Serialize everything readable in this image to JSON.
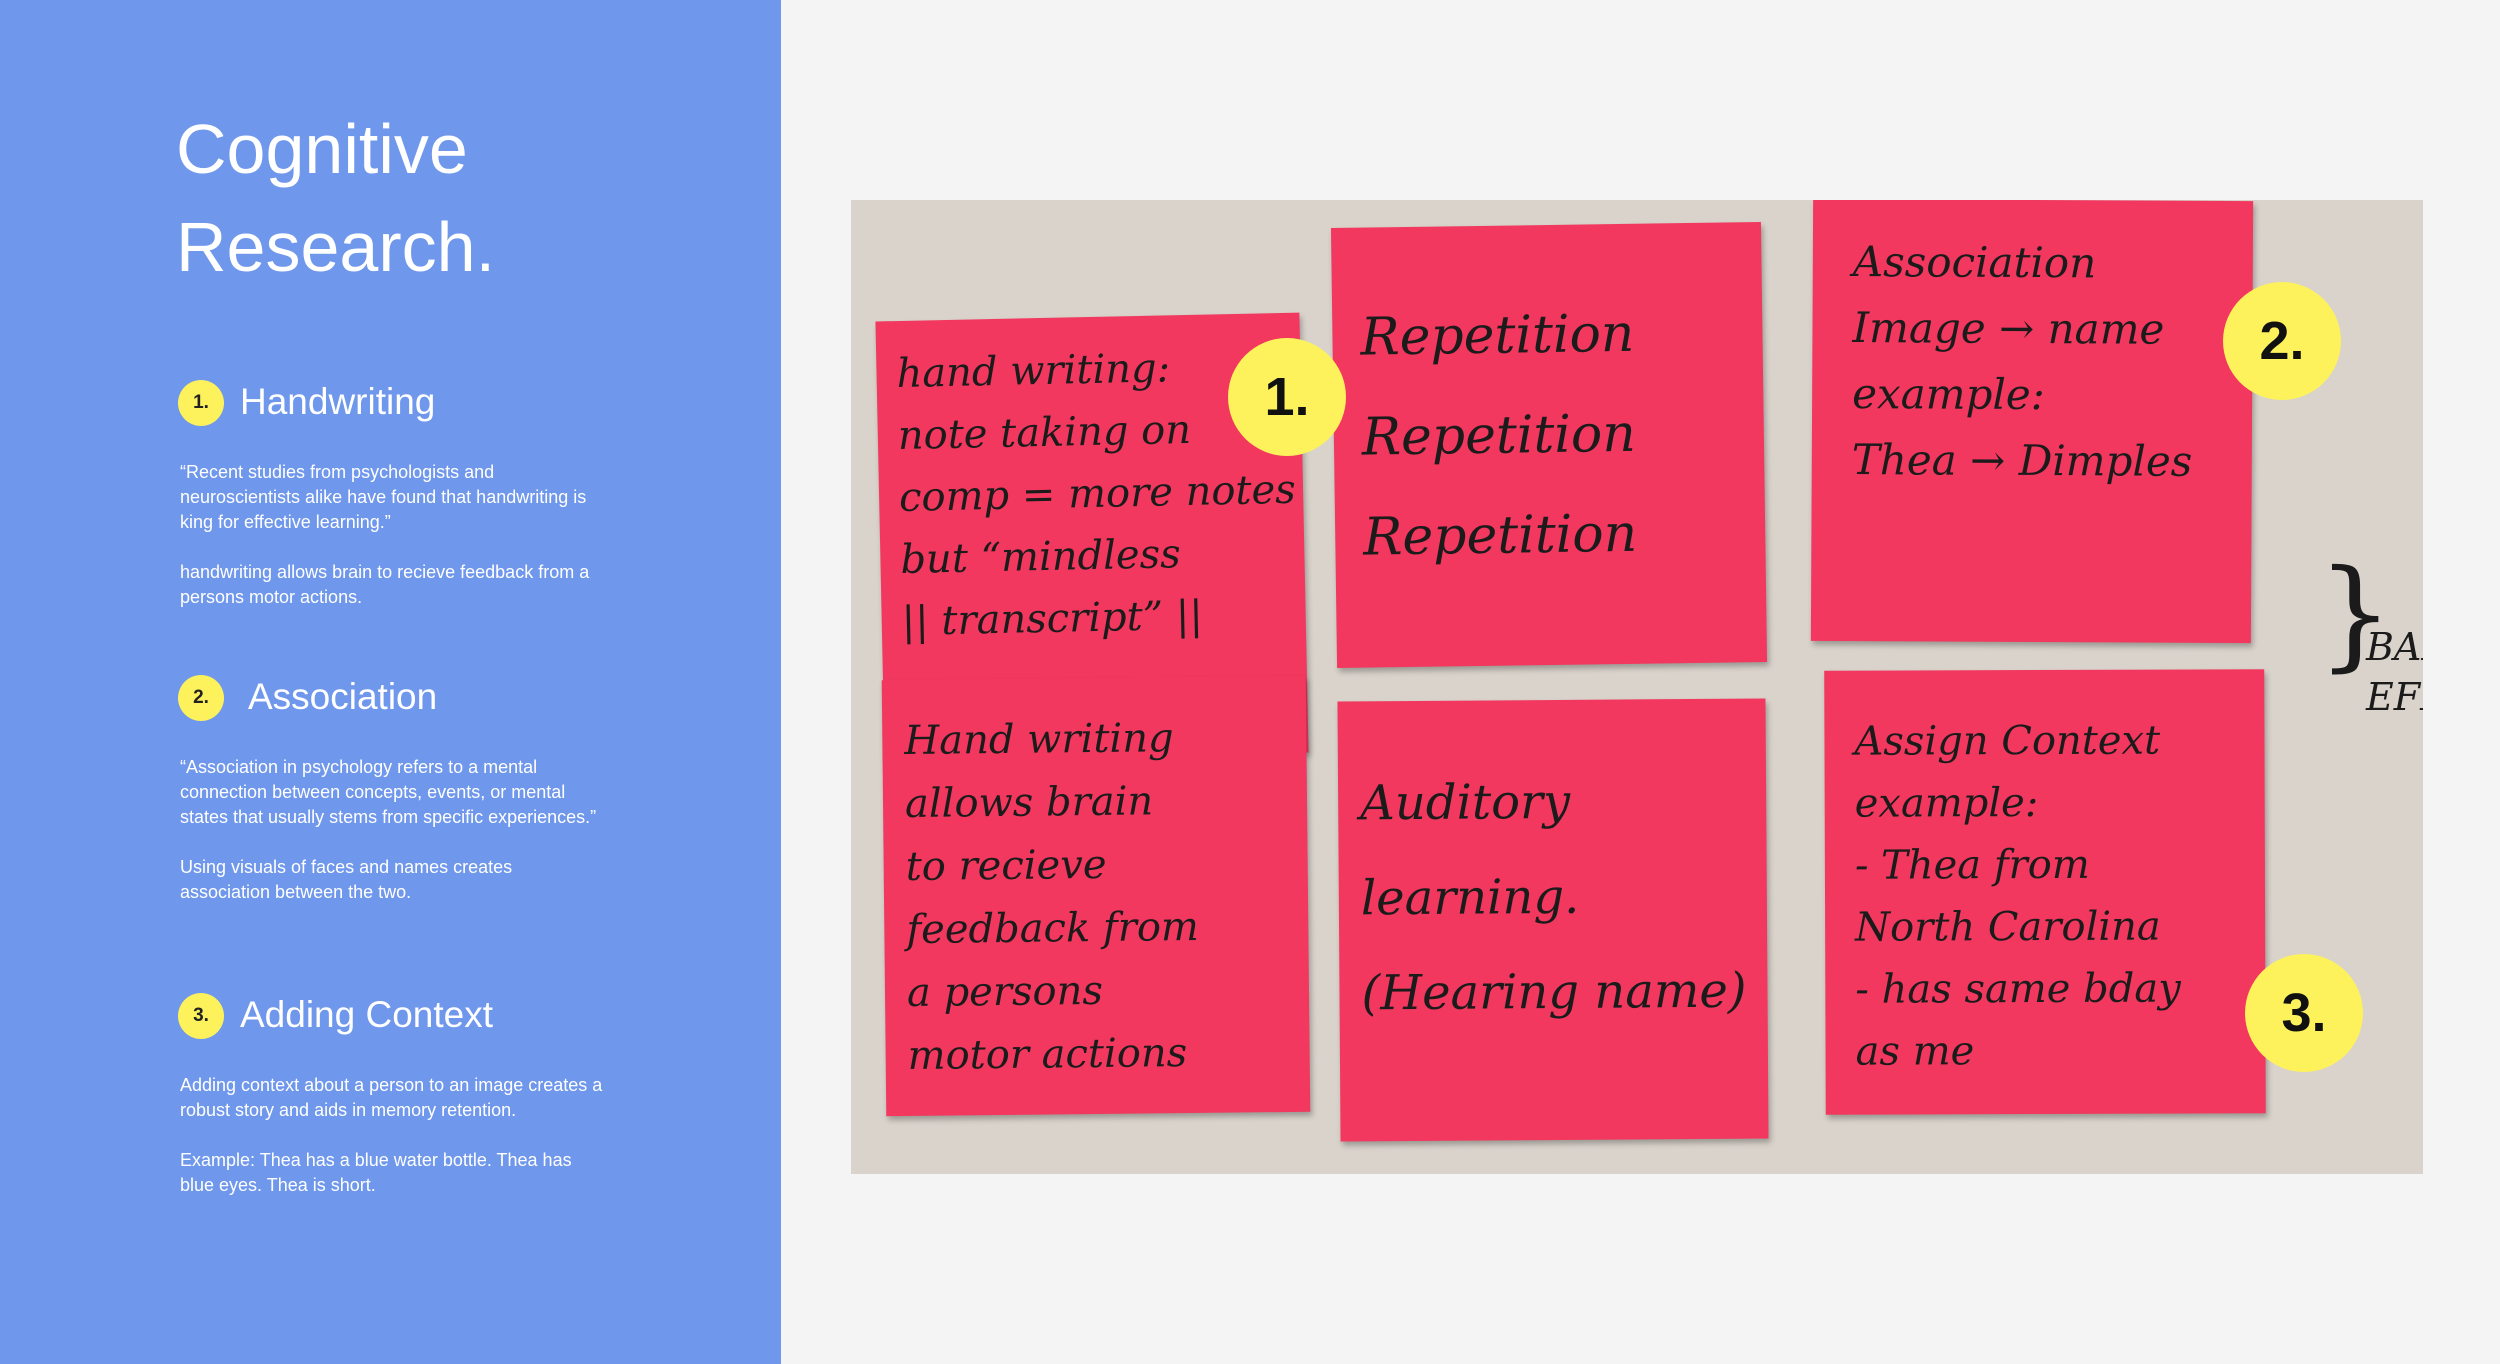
{
  "title": "Cognitive\nResearch.",
  "sections": [
    {
      "number": "1.",
      "heading": "Handwriting",
      "paragraphs": [
        "“Recent studies from psychologists and neuroscientists alike have found that handwriting is king for effective learning.”",
        "handwriting allows brain to recieve feedback from a persons motor actions."
      ]
    },
    {
      "number": "2.",
      "heading": "Association",
      "paragraphs": [
        "“Association in psychology refers to a mental connection between concepts, events, or mental states that usually stems from specific experiences.”",
        "Using visuals of faces and names creates association between the two."
      ]
    },
    {
      "number": "3.",
      "heading": "Adding Context",
      "paragraphs": [
        "Adding context about a person to an image creates a robust story and aids in memory retention.",
        "Example: Thea has a blue water bottle. Thea has blue eyes. Thea is short."
      ]
    }
  ],
  "photo": {
    "notes": [
      "hand writing:\nnote taking on\ncomp = more notes\nbut “mindless\n|| transcript” ||",
      "Hand writing\nallows brain\nto recieve\nfeedback from\na persons\nmotor actions",
      "Repetition\nRepetition\nRepetition",
      "Auditory\nlearning.\n(Hearing name)",
      "Association\nImage → name\nexample:\nThea → Dimples",
      "Assign Context\nexample:\n- Thea from\nNorth Carolina\n- has same bday\nas me"
    ],
    "markers": [
      "1.",
      "2.",
      "3."
    ],
    "edge_text": "BAKE\nEFFE"
  },
  "colors": {
    "panel": "#6f97eb",
    "badge": "#fdf25c",
    "sticky_note": "#f2385f",
    "background": "#f4f4f4"
  }
}
